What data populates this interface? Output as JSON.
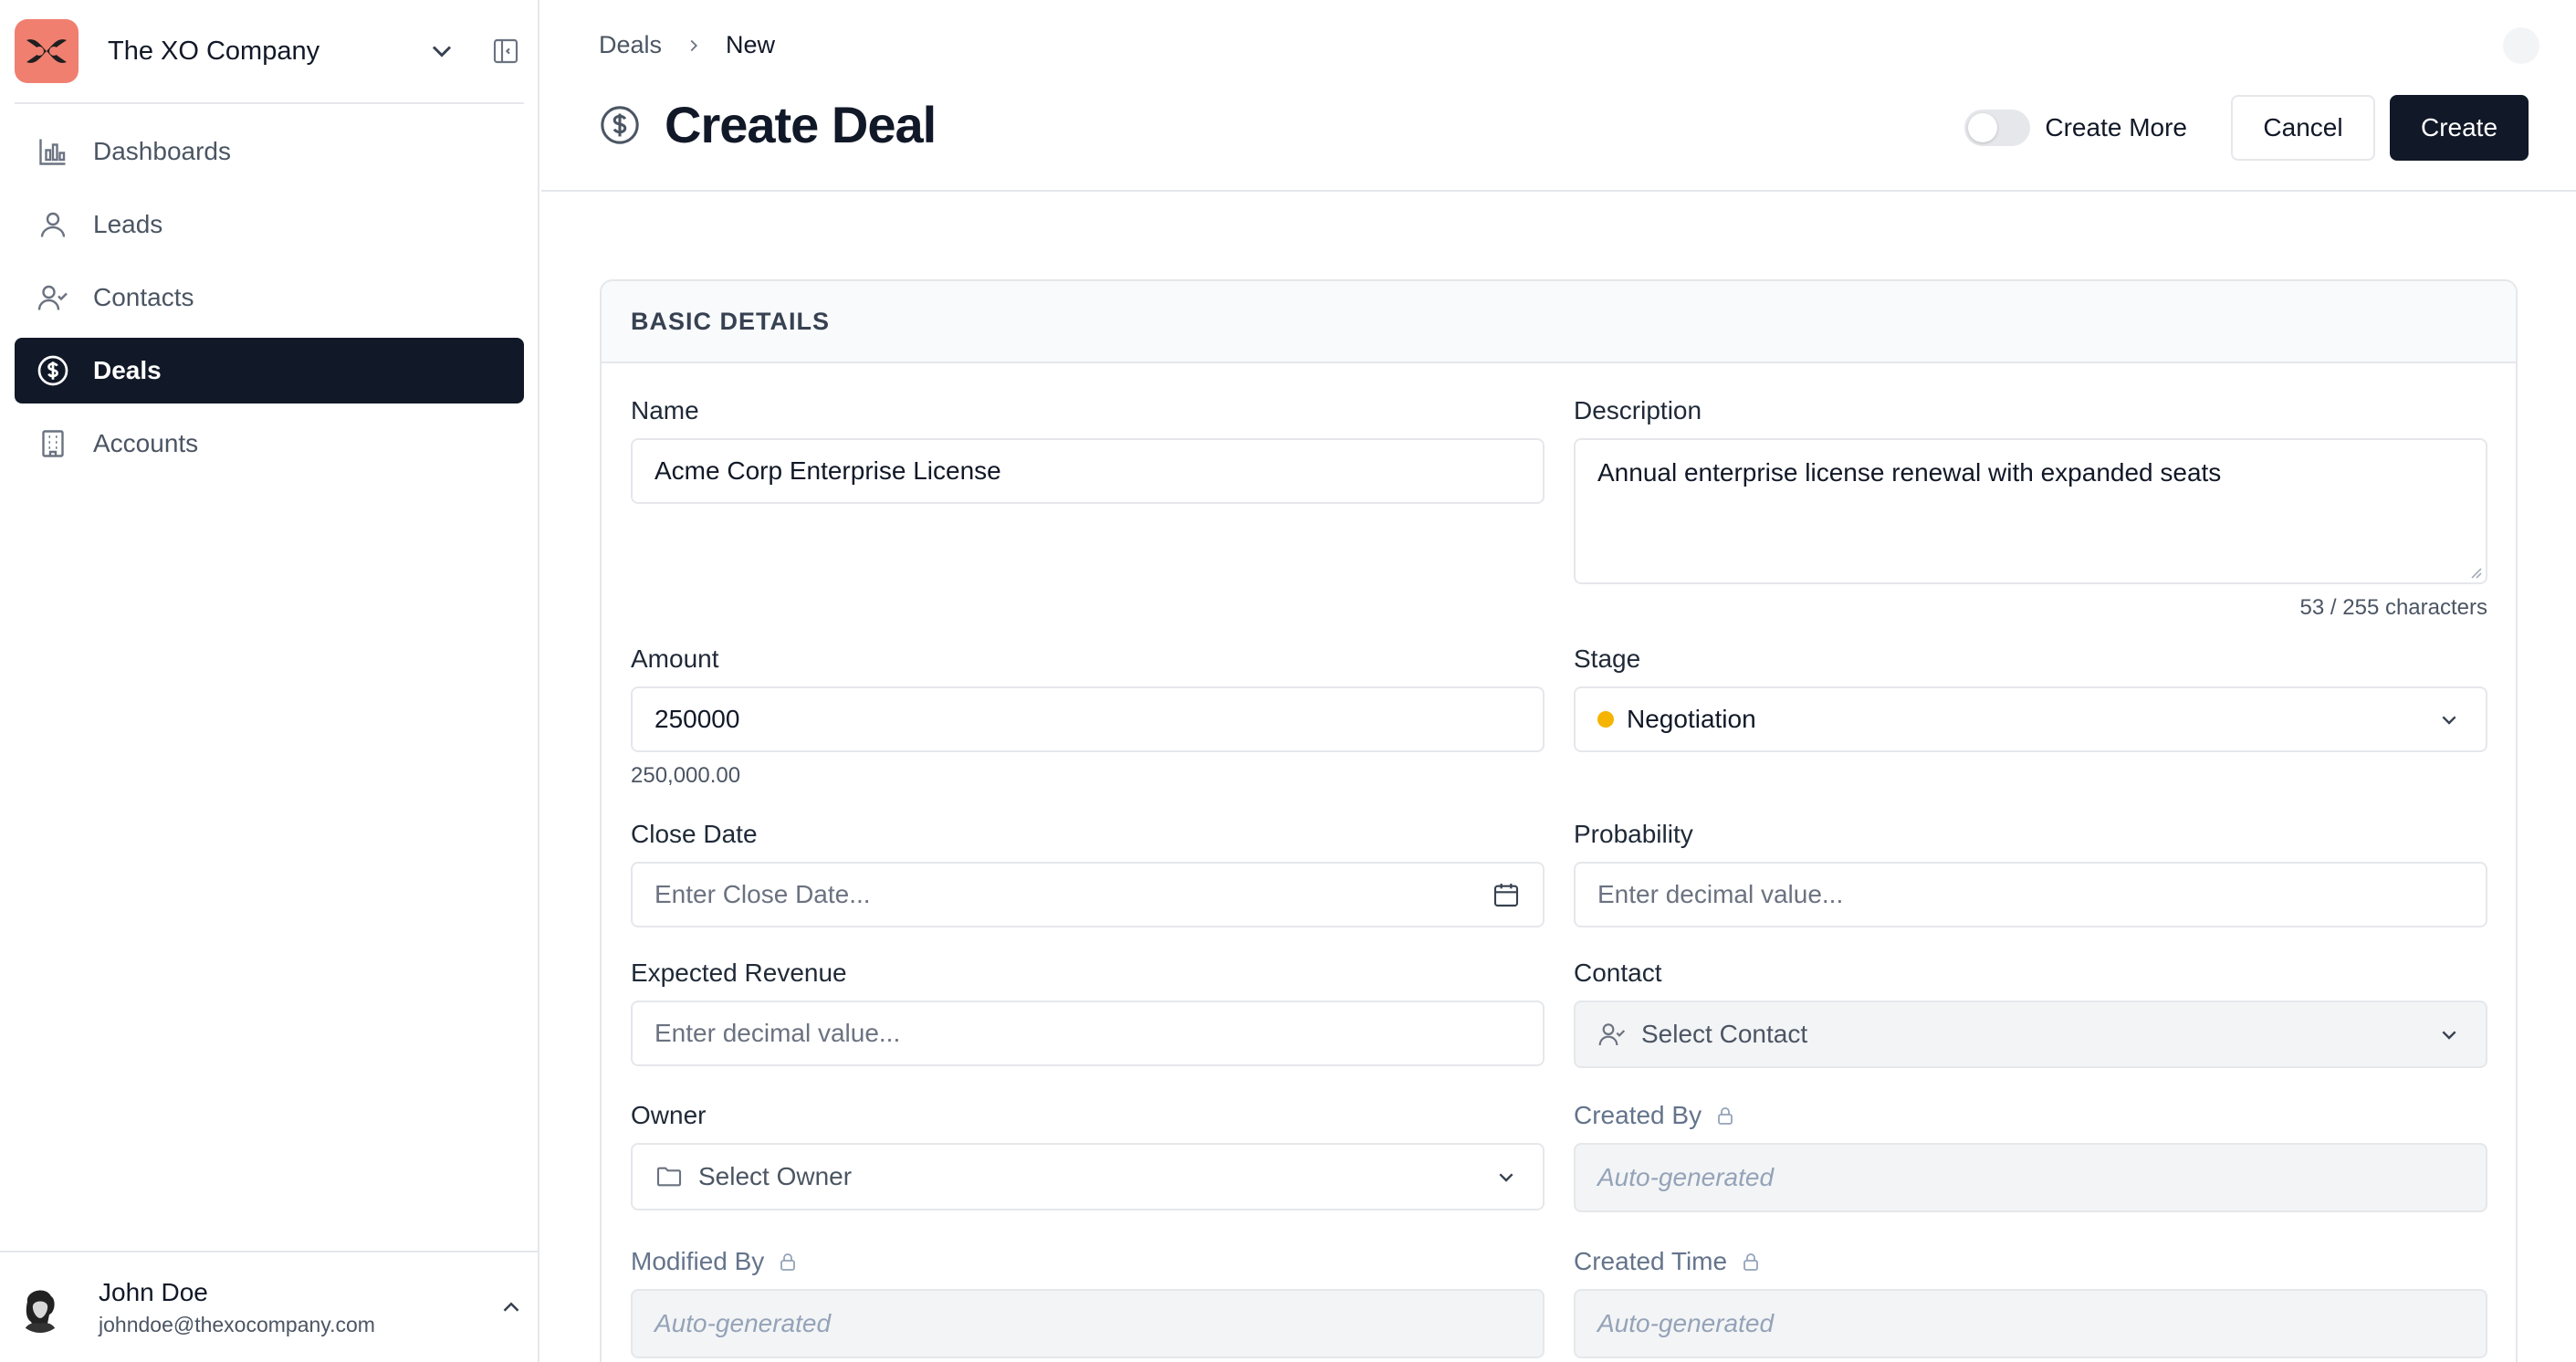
{
  "sidebar": {
    "company_name": "The XO Company",
    "items": [
      {
        "label": "Dashboards",
        "icon": "bar-chart-icon",
        "active": false
      },
      {
        "label": "Leads",
        "icon": "user-icon",
        "active": false
      },
      {
        "label": "Contacts",
        "icon": "user-check-icon",
        "active": false
      },
      {
        "label": "Deals",
        "icon": "dollar-circle-icon",
        "active": true
      },
      {
        "label": "Accounts",
        "icon": "building-icon",
        "active": false
      }
    ],
    "user": {
      "name": "John Doe",
      "email": "johndoe@thexocompany.com"
    }
  },
  "header": {
    "breadcrumb": {
      "parent": "Deals",
      "current": "New"
    },
    "title": "Create Deal",
    "create_more_label": "Create More",
    "create_more_on": false,
    "cancel_label": "Cancel",
    "create_label": "Create"
  },
  "form": {
    "section_title": "BASIC DETAILS",
    "name": {
      "label": "Name",
      "value": "Acme Corp Enterprise License"
    },
    "description": {
      "label": "Description",
      "value": "Annual enterprise license renewal with expanded seats",
      "counter": "53 / 255 characters"
    },
    "amount": {
      "label": "Amount",
      "value": "250000",
      "formatted": "250,000.00"
    },
    "stage": {
      "label": "Stage",
      "value": "Negotiation",
      "color": "#f5b400"
    },
    "close_date": {
      "label": "Close Date",
      "placeholder": "Enter Close Date..."
    },
    "probability": {
      "label": "Probability",
      "placeholder": "Enter decimal value..."
    },
    "expected_revenue": {
      "label": "Expected Revenue",
      "placeholder": "Enter decimal value..."
    },
    "contact": {
      "label": "Contact",
      "placeholder": "Select Contact"
    },
    "owner": {
      "label": "Owner",
      "placeholder": "Select Owner"
    },
    "created_by": {
      "label": "Created By",
      "placeholder": "Auto-generated"
    },
    "modified_by": {
      "label": "Modified By",
      "placeholder": "Auto-generated"
    },
    "created_time": {
      "label": "Created Time",
      "placeholder": "Auto-generated"
    }
  },
  "colors": {
    "primary": "#111827",
    "logo_bg": "#f07f70",
    "border": "#e5e7eb"
  }
}
